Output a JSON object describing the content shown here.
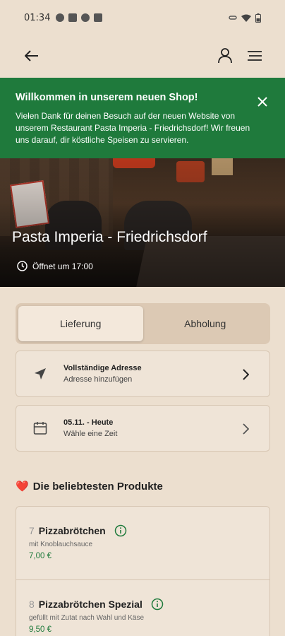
{
  "status_bar": {
    "time": "01:34"
  },
  "banner": {
    "title": "Willkommen in unserem neuen Shop!",
    "text": "Vielen Dank für deinen Besuch auf der neuen Website von unserem Restaurant Pasta Imperia - Friedrichsdorf! Wir freuen uns darauf, dir köstliche Speisen zu servieren."
  },
  "hero": {
    "title": "Pasta Imperia - Friedrichsdorf",
    "hours": "Öffnet um 17:00"
  },
  "toggle": {
    "delivery_label": "Lieferung",
    "pickup_label": "Abholung",
    "selected": "delivery"
  },
  "address_card": {
    "title": "Vollständige Adresse",
    "subtitle": "Adresse hinzufügen"
  },
  "time_card": {
    "title": "05.11. - Heute",
    "subtitle": "Wähle eine Zeit"
  },
  "popular": {
    "title": "Die beliebtesten Produkte",
    "emoji": "❤️",
    "products": [
      {
        "number": "7",
        "name": "Pizzabrötchen",
        "description": "mit Knoblauchsauce",
        "price": "7,00 €"
      },
      {
        "number": "8",
        "name": "Pizzabrötchen Spezial",
        "description": "gefüllt mit Zutat nach Wahl und Käse",
        "price": "9,50 €"
      }
    ]
  },
  "colors": {
    "brand_green": "#1f7a3c",
    "background": "#ecdfcf"
  }
}
